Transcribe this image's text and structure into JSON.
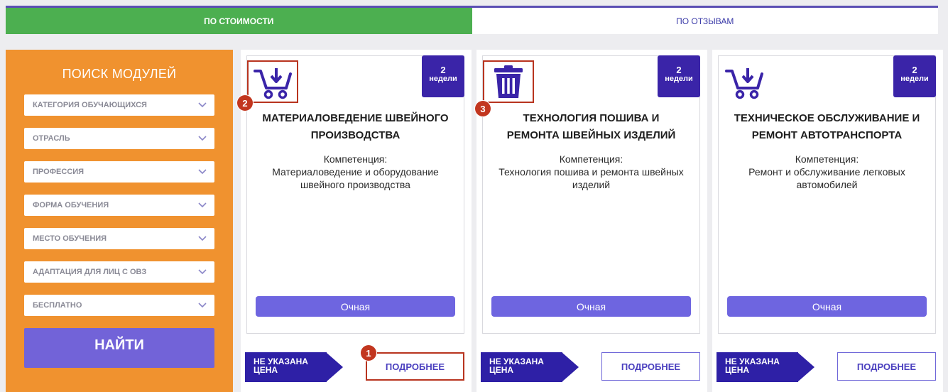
{
  "tabs": {
    "by_cost": "ПО СТОИМОСТИ",
    "by_reviews": "ПО ОТЗЫВАМ"
  },
  "sidebar": {
    "title": "ПОИСК МОДУЛЕЙ",
    "filters": [
      "КАТЕГОРИЯ ОБУЧАЮЩИХСЯ",
      "ОТРАСЛЬ",
      "ПРОФЕССИЯ",
      "ФОРМА ОБУЧЕНИЯ",
      "МЕСТО ОБУЧЕНИЯ",
      "АДАПТАЦИЯ ДЛЯ ЛИЦ С ОВЗ",
      "БЕСПЛАТНО"
    ],
    "find_label": "НАЙТИ"
  },
  "cards": [
    {
      "icon": "cart-icon",
      "duration_num": "2",
      "duration_unit": "недели",
      "title": "МАТЕРИАЛОВЕДЕНИЕ ШВЕЙНОГО ПРОИЗВОДСТВА",
      "competence_label": "Компетенция:",
      "competence": "Материаловедение и оборудование швейного производства",
      "form": "Очная",
      "price": "НЕ УКАЗАНА ЦЕНА",
      "details": "ПОДРОБНЕЕ"
    },
    {
      "icon": "trash-icon",
      "duration_num": "2",
      "duration_unit": "недели",
      "title": "ТЕХНОЛОГИЯ ПОШИВА И РЕМОНТА ШВЕЙНЫХ ИЗДЕЛИЙ",
      "competence_label": "Компетенция:",
      "competence": "Технология пошива и ремонта швейных изделий",
      "form": "Очная",
      "price": "НЕ УКАЗАНА ЦЕНА",
      "details": "ПОДРОБНЕЕ"
    },
    {
      "icon": "cart-icon",
      "duration_num": "2",
      "duration_unit": "недели",
      "title": "ТЕХНИЧЕСКОЕ ОБСЛУЖИВАНИЕ И РЕМОНТ АВТОТРАНСПОРТА",
      "competence_label": "Компетенция:",
      "competence": "Ремонт и обслуживание легковых автомобилей",
      "form": "Очная",
      "price": "НЕ УКАЗАНА ЦЕНА",
      "details": "ПОДРОБНЕЕ"
    }
  ],
  "steps": [
    "1",
    "2",
    "3"
  ],
  "colors": {
    "active_tab": "#4caf50",
    "sidebar": "#f0922f",
    "primary": "#3a24a8",
    "button": "#6e65e0",
    "highlight": "#b8341f"
  }
}
